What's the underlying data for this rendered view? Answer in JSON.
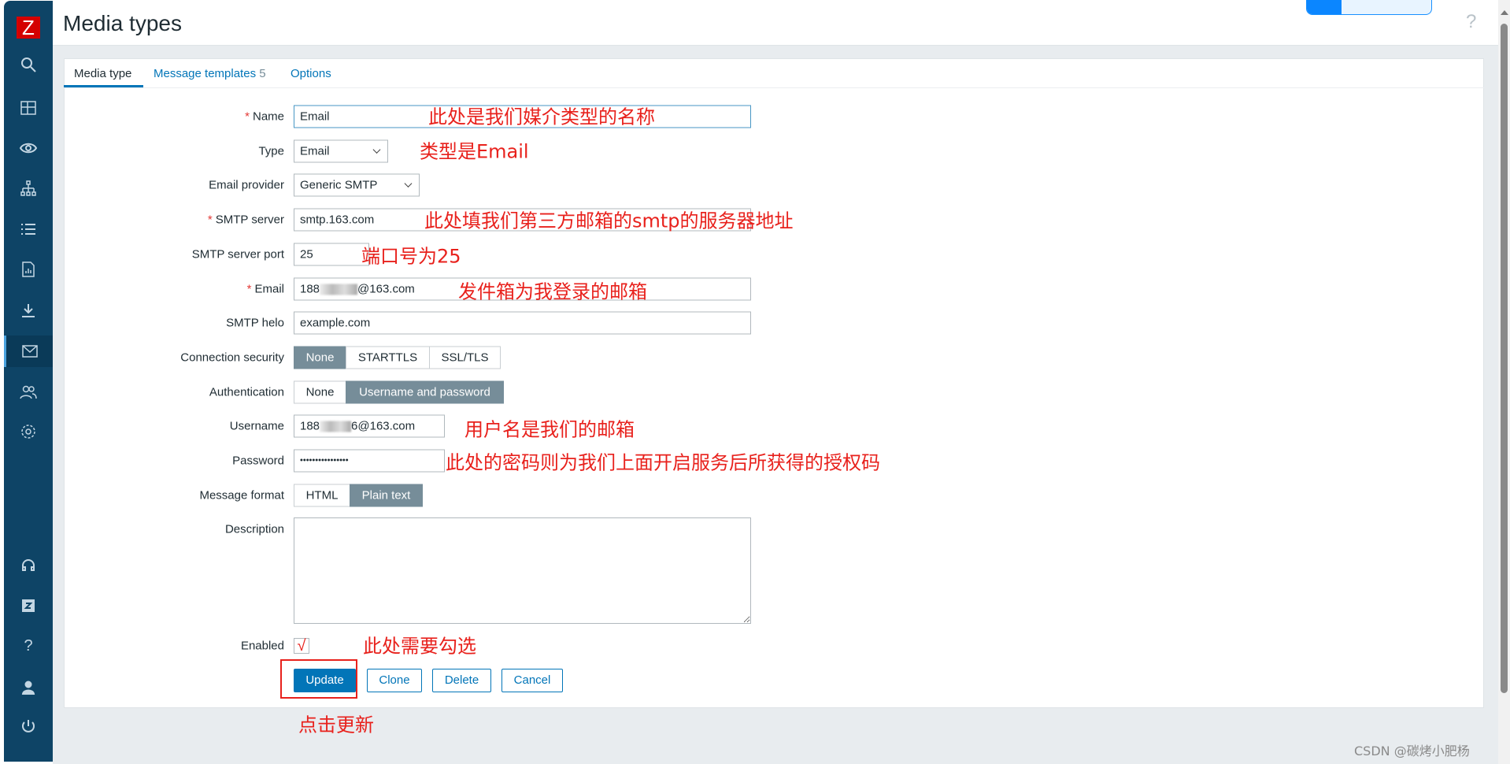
{
  "sidebar": {
    "logo": "Z",
    "items": [
      "search",
      "dashboards",
      "monitoring",
      "services",
      "inventory",
      "reports",
      "data-collection",
      "alerts",
      "users",
      "administration"
    ],
    "bottom_items": [
      "support",
      "integrations",
      "help",
      "user-settings",
      "sign-out"
    ]
  },
  "header": {
    "title": "Media types",
    "help": "?"
  },
  "tabs": [
    {
      "label": "Media type"
    },
    {
      "label": "Message templates",
      "count": "5"
    },
    {
      "label": "Options"
    }
  ],
  "form": {
    "name": {
      "label": "Name",
      "value": "Email"
    },
    "type": {
      "label": "Type",
      "value": "Email"
    },
    "provider": {
      "label": "Email provider",
      "value": "Generic SMTP"
    },
    "smtp_server": {
      "label": "SMTP server",
      "value": "smtp.163.com"
    },
    "smtp_port": {
      "label": "SMTP server port",
      "value": "25"
    },
    "email": {
      "label": "Email",
      "prefix": "188",
      "suffix": "@163.com"
    },
    "smtp_helo": {
      "label": "SMTP helo",
      "value": "example.com"
    },
    "connection_security": {
      "label": "Connection security",
      "options": [
        "None",
        "STARTTLS",
        "SSL/TLS"
      ],
      "selected": "None"
    },
    "authentication": {
      "label": "Authentication",
      "options": [
        "None",
        "Username and password"
      ],
      "selected": "Username and password"
    },
    "username": {
      "label": "Username",
      "prefix": "188",
      "suffix": "6@163.com"
    },
    "password": {
      "label": "Password",
      "value": "••••••••••••••••"
    },
    "message_format": {
      "label": "Message format",
      "options": [
        "HTML",
        "Plain text"
      ],
      "selected": "Plain text"
    },
    "description": {
      "label": "Description",
      "value": ""
    },
    "enabled": {
      "label": "Enabled",
      "checked": true,
      "mark": "√"
    }
  },
  "buttons": {
    "update": "Update",
    "clone": "Clone",
    "delete": "Delete",
    "cancel": "Cancel"
  },
  "annotations": {
    "name": "此处是我们媒介类型的名称",
    "type": "类型是Email",
    "smtp": "此处填我们第三方邮箱的smtp的服务器地址",
    "port": "端口号为25",
    "email": "发件箱为我登录的邮箱",
    "username": "用户名是我们的邮箱",
    "password": "此处的密码则为我们上面开启服务后所获得的授权码",
    "enabled": "此处需要勾选",
    "update": "点击更新"
  },
  "watermark": "CSDN @碳烤小肥杨",
  "colors": {
    "sidebar": "#0e4466",
    "accent": "#0275b8",
    "annotation": "#e8211c",
    "segment_selected": "#768d99"
  }
}
